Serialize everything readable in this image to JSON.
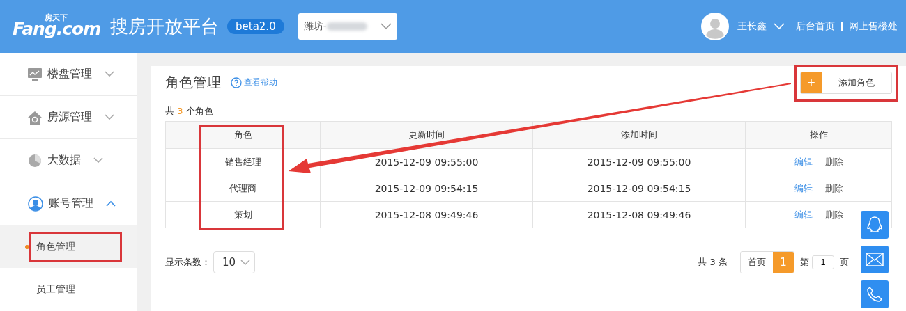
{
  "header": {
    "logo_small": "房天下",
    "logo": "Fang.com",
    "title": "搜房开放平台",
    "badge": "beta2.0",
    "city_select": {
      "value": "潍坊-"
    },
    "user": {
      "name": "王长鑫"
    },
    "links": [
      "后台首页",
      "网上售楼处"
    ]
  },
  "sidebar": {
    "items": [
      {
        "label": "楼盘管理",
        "expanded": false
      },
      {
        "label": "房源管理",
        "expanded": false
      },
      {
        "label": "大数据",
        "expanded": false
      },
      {
        "label": "账号管理",
        "expanded": true,
        "children": [
          {
            "label": "角色管理",
            "selected": true
          },
          {
            "label": "员工管理",
            "selected": false
          }
        ]
      }
    ]
  },
  "page": {
    "title": "角色管理",
    "help": "查看帮助",
    "add_button": {
      "icon": "+",
      "label": "添加角色"
    },
    "summary": {
      "prefix": "共",
      "count": "3",
      "suffix": "个角色"
    },
    "table": {
      "columns": [
        "角色",
        "更新时间",
        "添加时间",
        "操作"
      ],
      "rows": [
        {
          "role": "销售经理",
          "updated": "2015-12-09 09:55:00",
          "added": "2015-12-09 09:55:00",
          "actions": [
            "编辑",
            "删除"
          ]
        },
        {
          "role": "代理商",
          "updated": "2015-12-09 09:54:15",
          "added": "2015-12-09 09:54:15",
          "actions": [
            "编辑",
            "删除"
          ]
        },
        {
          "role": "策划",
          "updated": "2015-12-08 09:49:46",
          "added": "2015-12-08 09:49:46",
          "actions": [
            "编辑",
            "删除"
          ]
        }
      ]
    },
    "page_size": {
      "label": "显示条数：",
      "value": "10"
    },
    "pagination": {
      "total": "共 3 条",
      "first": "首页",
      "pages": [
        {
          "label": "1",
          "selected": true
        }
      ],
      "goto_prefix": "第",
      "goto_value": "1",
      "goto_suffix": "页"
    }
  }
}
